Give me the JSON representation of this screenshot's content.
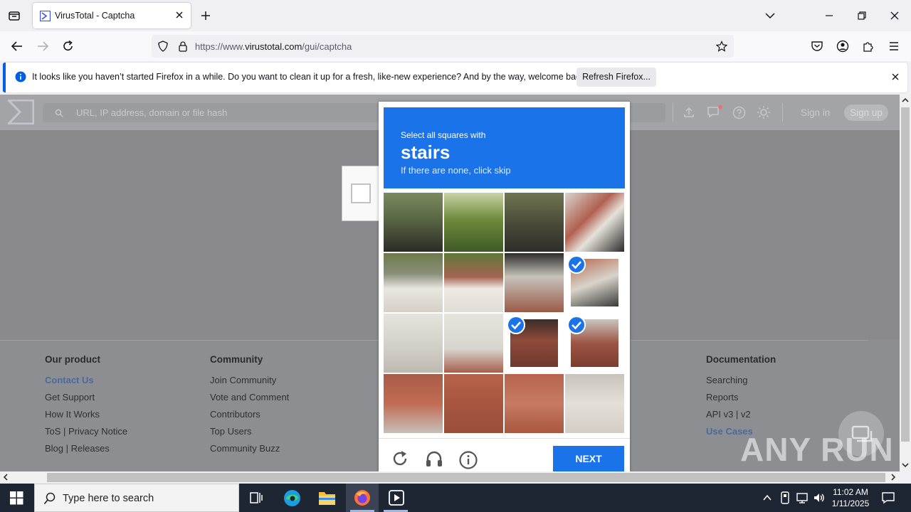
{
  "browser": {
    "tab_title": "VirusTotal - Captcha",
    "url_prefix": "https://www.",
    "url_host": "virustotal.com",
    "url_path": "/gui/captcha"
  },
  "notification": {
    "message": "It looks like you haven’t started Firefox in a while. Do you want to clean it up for a fresh, like-new experience? And by the way, welcome back!",
    "button": "Refresh Firefox..."
  },
  "vt_header": {
    "search_placeholder": "URL, IP address, domain or file hash",
    "sign_in": "Sign in",
    "sign_up": "Sign up"
  },
  "captcha": {
    "prompt_line1": "Select all squares with",
    "prompt_keyword": "stairs",
    "prompt_line3": "If there are none, click skip",
    "next_label": "NEXT",
    "selected_cells": [
      7,
      10,
      11
    ]
  },
  "footer": {
    "product": {
      "heading": "Our product",
      "items": [
        "Contact Us",
        "Get Support",
        "How It Works",
        "ToS | Privacy Notice",
        "Blog | Releases"
      ]
    },
    "community": {
      "heading": "Community",
      "items": [
        "Join Community",
        "Vote and Comment",
        "Contributors",
        "Top Users",
        "Community Buzz"
      ]
    },
    "documentation": {
      "heading": "Documentation",
      "items": [
        "Searching",
        "Reports",
        "API v3 | v2",
        "Use Cases"
      ]
    }
  },
  "taskbar": {
    "search_placeholder": "Type here to search",
    "time": "11:02 AM",
    "date": "1/11/2025"
  },
  "watermark": "ANY RUN",
  "colors": {
    "accent": "#1a73e8",
    "notif_accent": "#0060df",
    "taskbar": "#1f2633"
  }
}
